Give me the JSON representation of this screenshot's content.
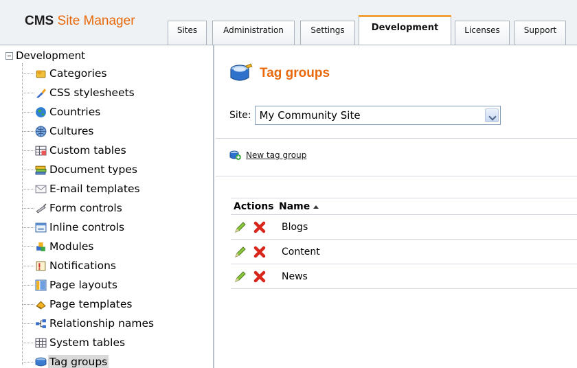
{
  "app": {
    "logo_prefix": "CMS",
    "logo_suffix": "Site Manager"
  },
  "tabs": [
    {
      "label": "Sites",
      "active": false
    },
    {
      "label": "Administration",
      "active": false
    },
    {
      "label": "Settings",
      "active": false
    },
    {
      "label": "Development",
      "active": true
    },
    {
      "label": "Licenses",
      "active": false
    },
    {
      "label": "Support",
      "active": false
    }
  ],
  "tree": {
    "root_label": "Development",
    "items": [
      {
        "label": "Categories",
        "icon": "categories-icon"
      },
      {
        "label": "CSS stylesheets",
        "icon": "css-stylesheets-icon"
      },
      {
        "label": "Countries",
        "icon": "globe-icon"
      },
      {
        "label": "Cultures",
        "icon": "cultures-globe-icon"
      },
      {
        "label": "Custom tables",
        "icon": "custom-table-icon"
      },
      {
        "label": "Document types",
        "icon": "document-types-icon"
      },
      {
        "label": "E-mail templates",
        "icon": "envelope-icon"
      },
      {
        "label": "Form controls",
        "icon": "form-controls-icon"
      },
      {
        "label": "Inline controls",
        "icon": "inline-controls-icon"
      },
      {
        "label": "Modules",
        "icon": "modules-icon"
      },
      {
        "label": "Notifications",
        "icon": "notifications-icon"
      },
      {
        "label": "Page layouts",
        "icon": "page-layouts-icon"
      },
      {
        "label": "Page templates",
        "icon": "page-templates-icon"
      },
      {
        "label": "Relationship names",
        "icon": "relationship-icon"
      },
      {
        "label": "System tables",
        "icon": "system-tables-icon"
      },
      {
        "label": "Tag groups",
        "icon": "tag-groups-icon",
        "selected": true
      }
    ]
  },
  "main": {
    "title": "Tag groups",
    "site_label": "Site:",
    "site_value": "My Community Site",
    "new_link": "New tag group",
    "grid": {
      "col_actions": "Actions",
      "col_name": "Name",
      "rows": [
        "Blogs",
        "Content",
        "News"
      ]
    }
  },
  "colors": {
    "accent_orange": "#e8680a",
    "selection_gray": "#d9d9d9"
  }
}
